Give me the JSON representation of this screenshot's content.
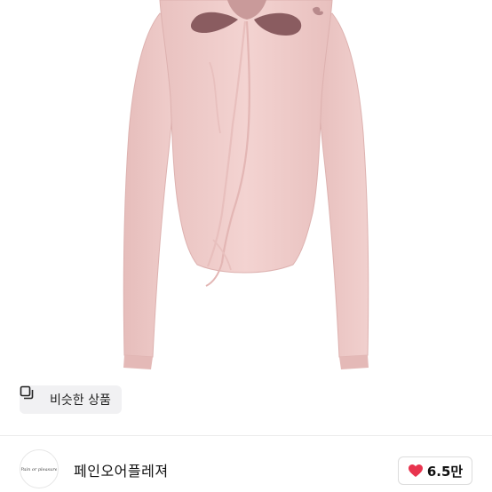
{
  "product": {
    "image_alt": "pink long-sleeve top with cutouts and ties"
  },
  "similar": {
    "label": "비슷한 상품",
    "icon": "copy-icon"
  },
  "shop": {
    "name": "페인오어플레져",
    "logo_text": "Pain or pleasure"
  },
  "likes": {
    "count": "6.5만",
    "icon": "heart-icon",
    "color": "#e8344e"
  }
}
